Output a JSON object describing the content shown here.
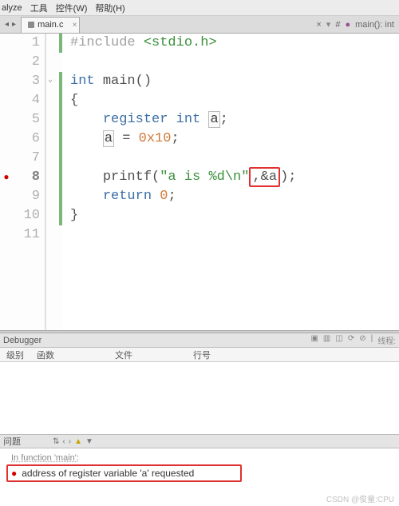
{
  "menubar": {
    "items": [
      "alyze",
      "工具",
      "控件(W)",
      "帮助(H)"
    ]
  },
  "tab": {
    "filename": "main.c",
    "close_label": "×"
  },
  "breadcrumb": {
    "hash": "#",
    "func_dot": "●",
    "func": "main(): int"
  },
  "code": {
    "lines": [
      {
        "n": "1"
      },
      {
        "n": "2"
      },
      {
        "n": "3"
      },
      {
        "n": "4"
      },
      {
        "n": "5"
      },
      {
        "n": "6"
      },
      {
        "n": "7"
      },
      {
        "n": "8"
      },
      {
        "n": "9"
      },
      {
        "n": "10"
      },
      {
        "n": "11"
      }
    ],
    "tok": {
      "include": "#include",
      "stdio": "<stdio.h>",
      "int": "int",
      "register": "register",
      "main": "main",
      "a": "a",
      "hex": "0x10",
      "eq": " = ",
      "semi": ";",
      "printf": "printf",
      "lparen": "(",
      "rparen": ")",
      "lbrace": "{",
      "rbrace": "}",
      "str1": "\"a is %d",
      "esc": "\\n",
      "str2": "\"",
      "comma_amp_a": ",&a",
      "return": "return",
      "zero": "0"
    },
    "error_line": 8,
    "fold_line": 3
  },
  "debugger": {
    "title": "Debugger",
    "cols": {
      "level": "级别",
      "func": "函数",
      "file": "文件",
      "line": "行号"
    },
    "thread_label": "线程:"
  },
  "problems": {
    "title": "问题",
    "context": "In function 'main':",
    "error": "address of register variable 'a' requested"
  },
  "watermark": "CSDN @俊童:CPU"
}
